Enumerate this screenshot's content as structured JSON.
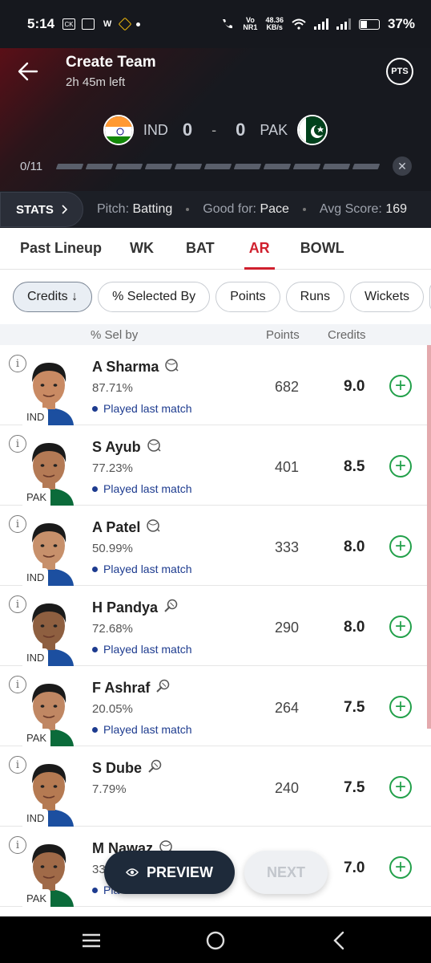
{
  "status_bar": {
    "time": "5:14",
    "net_line1": "Vo",
    "net_line2": "NR1",
    "speed_line1": "48.36",
    "speed_line2": "KB/s",
    "battery": "37%"
  },
  "header": {
    "title": "Create Team",
    "time_left": "2h 45m left",
    "pts_label": "PTS",
    "team1": "IND",
    "team2": "PAK",
    "score1": "0",
    "score2": "0",
    "separator": "-",
    "selected_count": "0/11",
    "max_players": 11,
    "selected_players": 0
  },
  "stats_strip": {
    "button": "STATS",
    "pitch_label": "Pitch:",
    "pitch_value": "Batting",
    "good_for_label": "Good for:",
    "good_for_value": "Pace",
    "avg_score_label": "Avg Score:",
    "avg_score_value": "169"
  },
  "tabs": [
    {
      "label": "Past Lineup",
      "active": false
    },
    {
      "label": "WK",
      "active": false
    },
    {
      "label": "BAT",
      "active": false
    },
    {
      "label": "AR",
      "active": true
    },
    {
      "label": "BOWL",
      "active": false
    }
  ],
  "filters": [
    {
      "label": "Credits ↓",
      "selected": true
    },
    {
      "label": "% Selected By",
      "selected": false
    },
    {
      "label": "Points",
      "selected": false
    },
    {
      "label": "Runs",
      "selected": false
    },
    {
      "label": "Wickets",
      "selected": false
    }
  ],
  "columns": {
    "sel_by": "% Sel by",
    "points": "Points",
    "credits": "Credits"
  },
  "players": [
    {
      "name": "A Sharma",
      "team": "IND",
      "sel": "87.71%",
      "played": "Played last match",
      "points": "682",
      "credits": "9.0",
      "role_icon": "bowling-ball-icon"
    },
    {
      "name": "S Ayub",
      "team": "PAK",
      "sel": "77.23%",
      "played": "Played last match",
      "points": "401",
      "credits": "8.5",
      "role_icon": "bowling-ball-icon"
    },
    {
      "name": "A Patel",
      "team": "IND",
      "sel": "50.99%",
      "played": "Played last match",
      "points": "333",
      "credits": "8.0",
      "role_icon": "bowling-ball-icon"
    },
    {
      "name": "H Pandya",
      "team": "IND",
      "sel": "72.68%",
      "played": "Played last match",
      "points": "290",
      "credits": "8.0",
      "role_icon": "bat-ball-icon"
    },
    {
      "name": "F Ashraf",
      "team": "PAK",
      "sel": "20.05%",
      "played": "Played last match",
      "points": "264",
      "credits": "7.5",
      "role_icon": "bat-ball-icon"
    },
    {
      "name": "S Dube",
      "team": "IND",
      "sel": "7.79%",
      "played": "",
      "points": "240",
      "credits": "7.5",
      "role_icon": "bat-ball-icon"
    },
    {
      "name": "M Nawaz",
      "team": "PAK",
      "sel": "33",
      "played": "Pla",
      "points": "",
      "credits": "7.0",
      "role_icon": "bowling-ball-icon"
    }
  ],
  "actions": {
    "preview": "PREVIEW",
    "next": "NEXT"
  },
  "colors": {
    "accent_red": "#d0202e",
    "add_green": "#22a04a",
    "played_blue": "#1d3b8f",
    "header_dark": "#17191f"
  }
}
